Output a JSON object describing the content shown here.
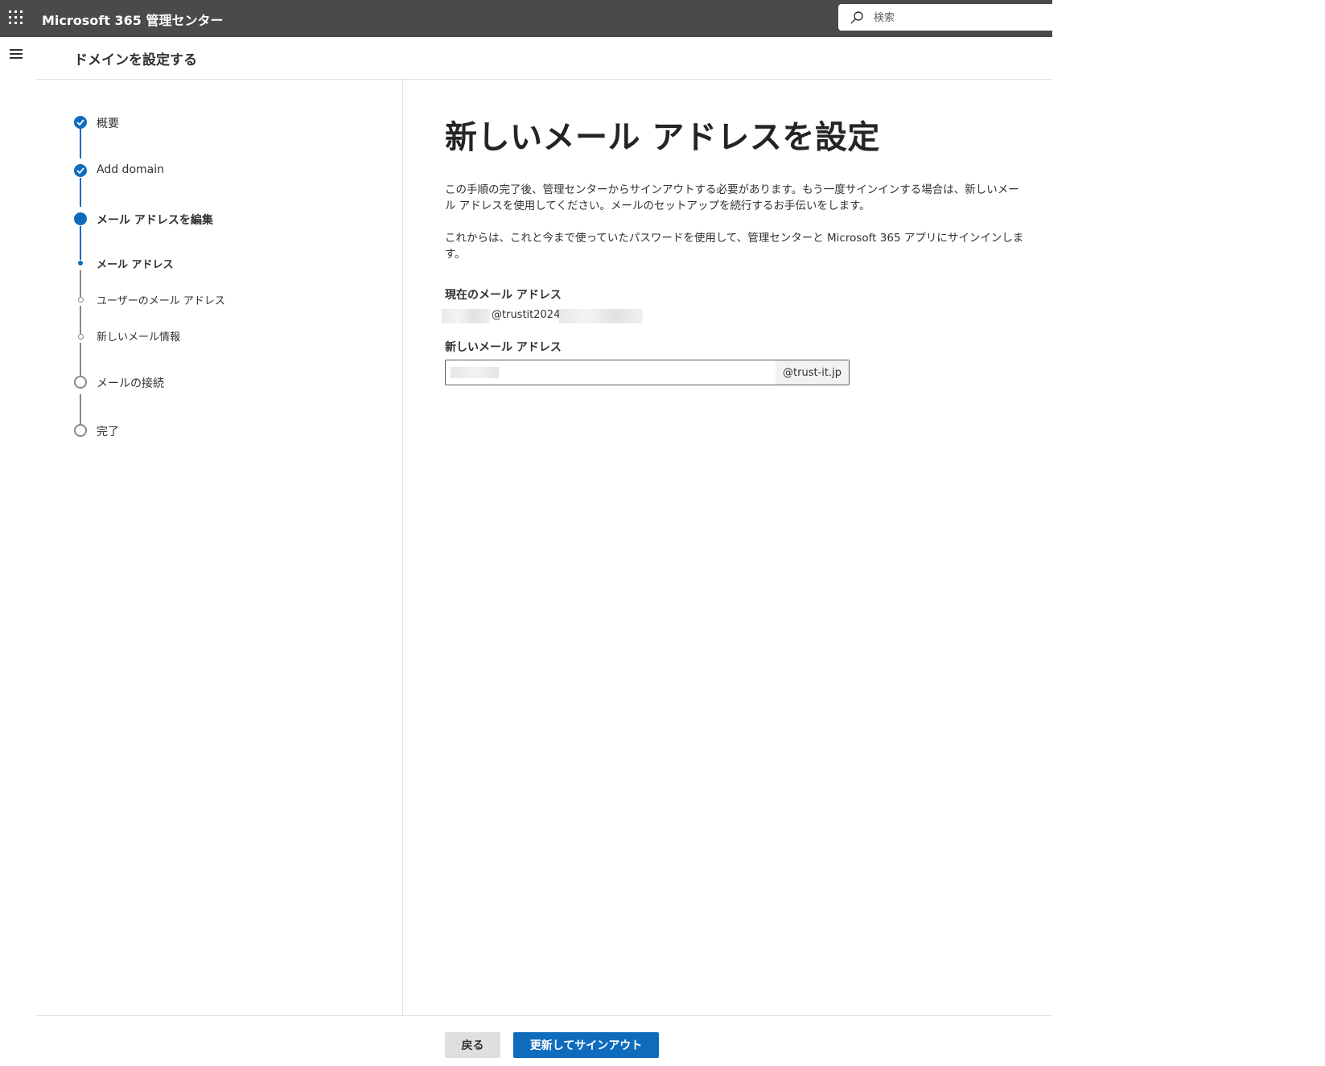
{
  "topbar": {
    "app_title": "Microsoft 365 管理センター",
    "search_placeholder": "検索"
  },
  "header": {
    "page_title": "ドメインを設定する"
  },
  "stepper": {
    "steps": [
      {
        "label": "概要",
        "state": "complete"
      },
      {
        "label": "Add domain",
        "state": "complete"
      },
      {
        "label": "メール アドレスを編集",
        "state": "current"
      },
      {
        "label": "メールの接続",
        "state": "pending"
      },
      {
        "label": "完了",
        "state": "pending"
      }
    ],
    "substeps": [
      {
        "label": "メール アドレス",
        "state": "current"
      },
      {
        "label": "ユーザーのメール アドレス",
        "state": "pending"
      },
      {
        "label": "新しいメール情報",
        "state": "pending"
      }
    ]
  },
  "main": {
    "title": "新しいメール アドレスを設定",
    "paragraph1": "この手順の完了後、管理センターからサインアウトする必要があります。もう一度サインインする場合は、新しいメール アドレスを使用してください。メールのセットアップを続行するお手伝いをします。",
    "paragraph2": "これからは、これと今まで使っていたパスワードを使用して、管理センターと Microsoft 365 アプリにサインインします。",
    "current_email_label": "現在のメール アドレス",
    "current_email_visible": "@trustit2024.c",
    "new_email_label": "新しいメール アドレス",
    "new_email_suffix": "@trust-it.jp"
  },
  "footer": {
    "back_label": "戻る",
    "primary_label": "更新してサインアウト"
  },
  "colors": {
    "topbar": "#4a4a4a",
    "accent": "#0f6cbd"
  }
}
